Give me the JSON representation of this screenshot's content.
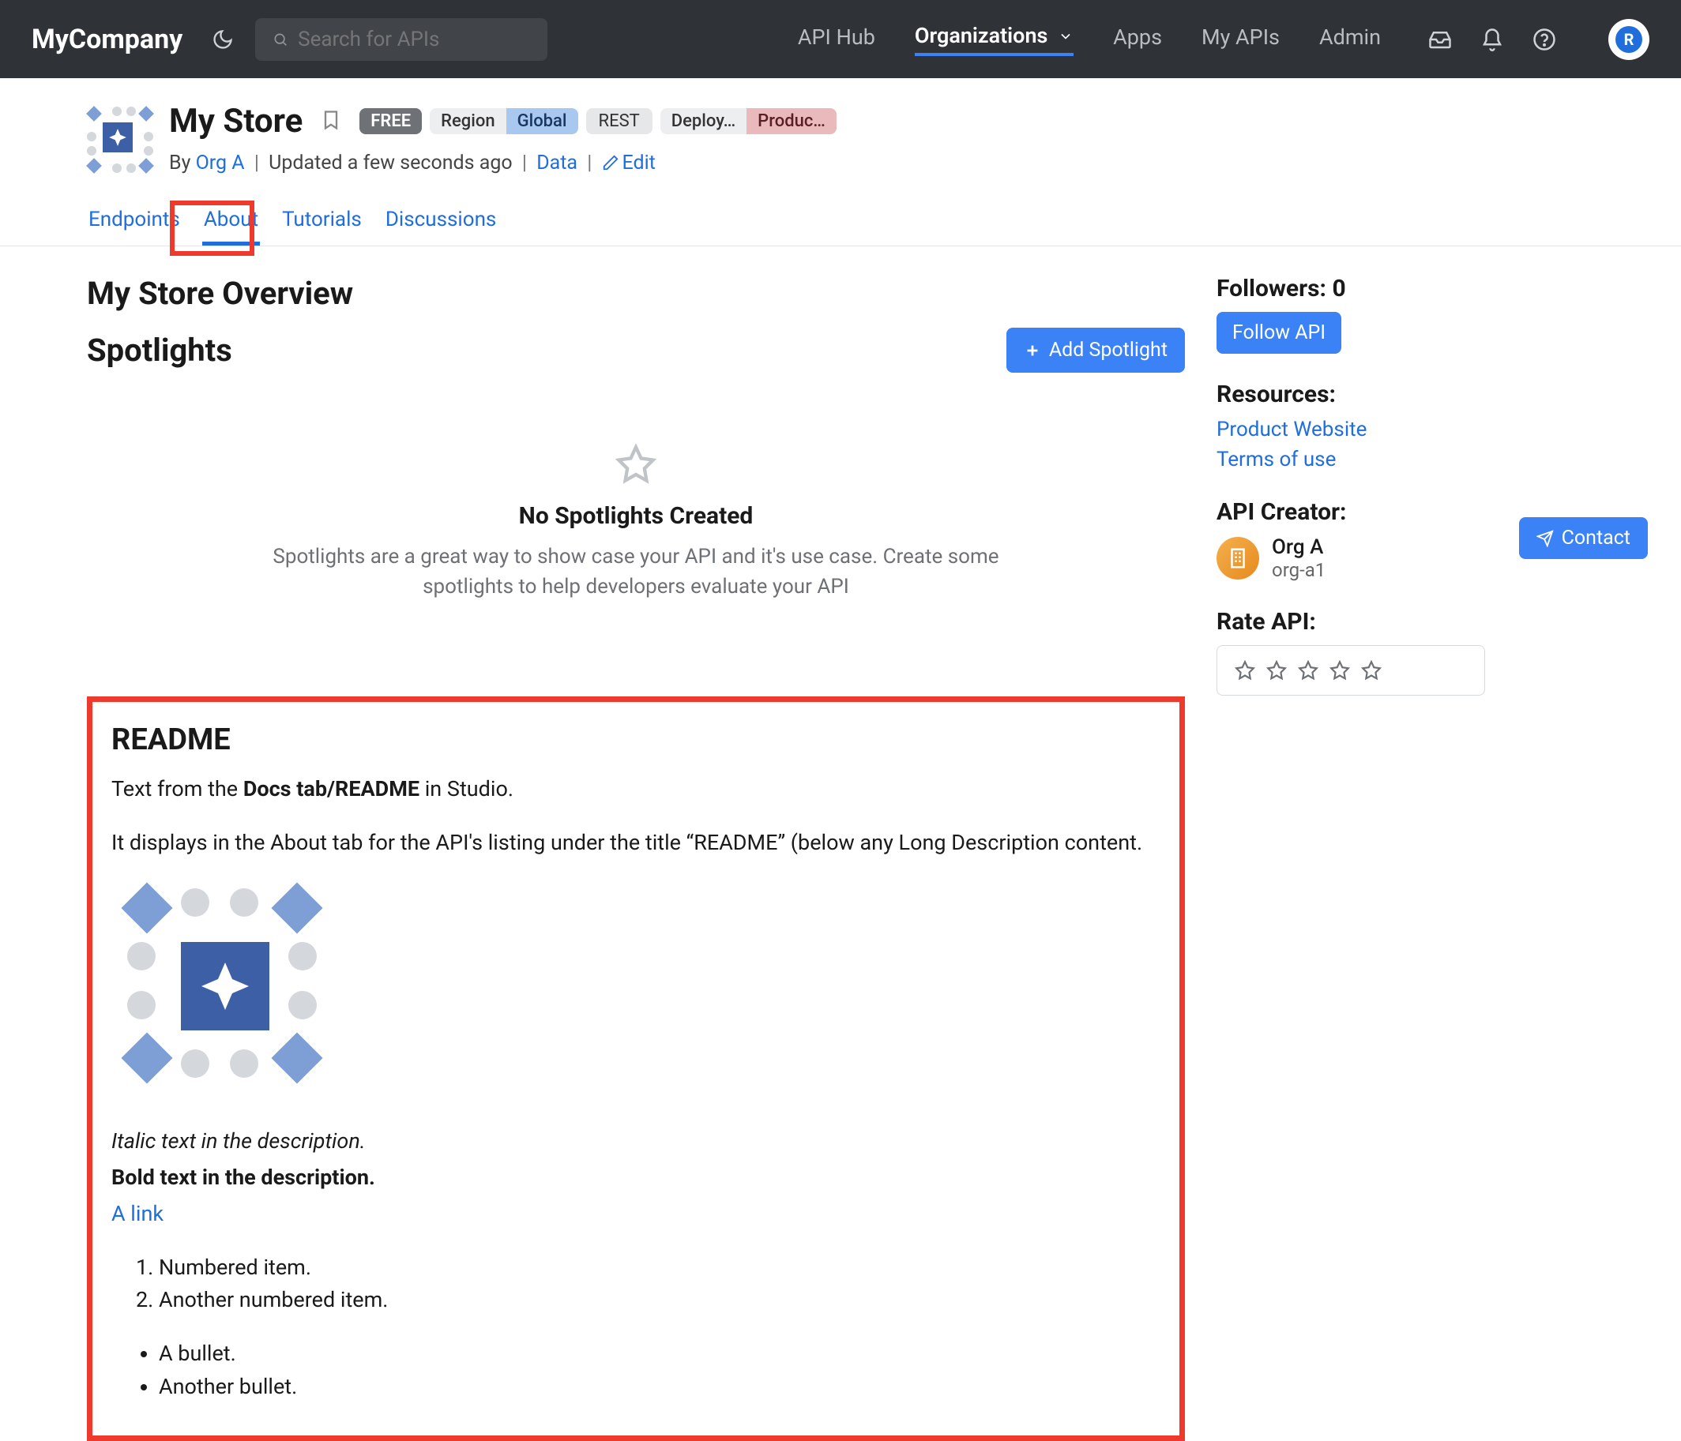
{
  "brand": "MyCompany",
  "search": {
    "placeholder": "Search for APIs"
  },
  "nav": {
    "hub": "API Hub",
    "orgs": "Organizations",
    "apps": "Apps",
    "myapis": "My APIs",
    "admin": "Admin"
  },
  "api": {
    "title": "My Store",
    "badges": {
      "free": "FREE",
      "regionLabel": "Region",
      "regionValue": "Global",
      "rest": "REST",
      "deploy": "Deploy…",
      "product": "Produc…"
    },
    "byline_by": "By ",
    "byline_org": "Org A",
    "byline_updated": "Updated a few seconds ago",
    "data": "Data",
    "edit": "Edit"
  },
  "tabs": {
    "endpoints": "Endpoints",
    "about": "About",
    "tutorials": "Tutorials",
    "discussions": "Discussions"
  },
  "overview": {
    "heading": "My Store Overview",
    "spotlights": "Spotlights",
    "addSpotlight": "Add Spotlight",
    "emptyTitle": "No Spotlights Created",
    "emptySub": "Spotlights are a great way to show case your API and it's use case. Create some spotlights to help developers evaluate your API"
  },
  "side": {
    "followersLabel": "Followers: 0",
    "followBtn": "Follow API",
    "resources": "Resources:",
    "link1": "Product Website",
    "link2": "Terms of use",
    "creatorHdr": "API Creator:",
    "creatorName": "Org A",
    "creatorSlug": "org-a1",
    "rateHdr": "Rate API:",
    "contact": "Contact"
  },
  "readme": {
    "heading": "README",
    "p1_pre": "Text from the ",
    "p1_bold": "Docs tab/README",
    "p1_post": " in Studio.",
    "p2": "It displays in the About tab for the API's listing under the title “README” (below any Long Description content.",
    "italic": "Italic text in the description.",
    "bold": "Bold text in the description.",
    "link": "A link",
    "ol1": "Numbered item.",
    "ol2": "Another numbered item.",
    "ul1": "A bullet.",
    "ul2": "Another bullet."
  }
}
